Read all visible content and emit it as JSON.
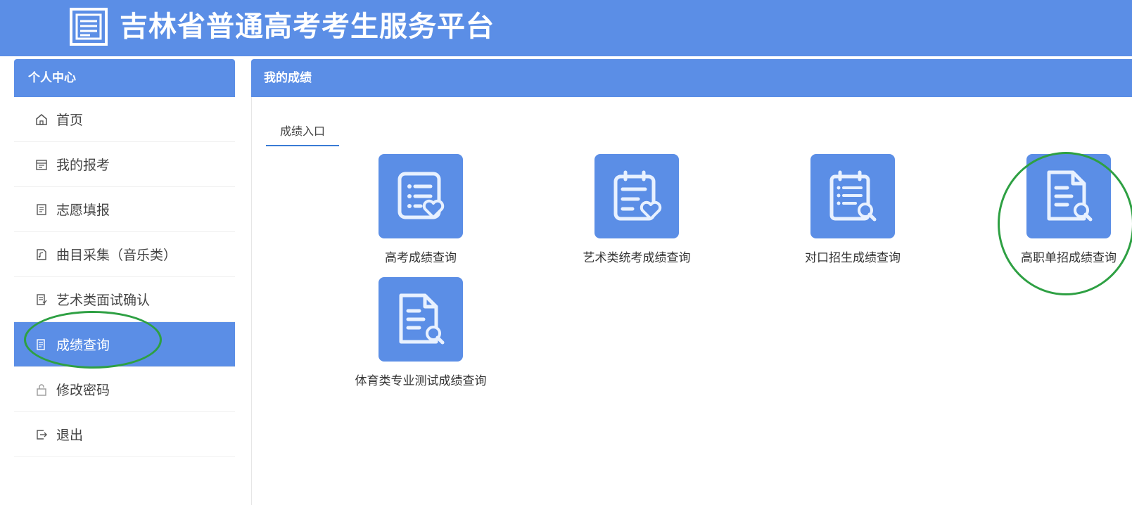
{
  "header": {
    "title": "吉林省普通高考考生服务平台",
    "logo_icon": "document-logo-icon",
    "bg_color": "#5b8ee6"
  },
  "sidebar": {
    "title": "个人中心",
    "items": [
      {
        "label": "首页",
        "icon": "home-icon"
      },
      {
        "label": "我的报考",
        "icon": "calendar-icon"
      },
      {
        "label": "志愿填报",
        "icon": "form-icon"
      },
      {
        "label": "曲目采集（音乐类）",
        "icon": "music-file-icon"
      },
      {
        "label": "艺术类面试确认",
        "icon": "confirm-doc-icon"
      },
      {
        "label": "成绩查询",
        "icon": "score-doc-icon",
        "active": true
      },
      {
        "label": "修改密码",
        "icon": "lock-icon"
      },
      {
        "label": "退出",
        "icon": "logout-icon"
      }
    ]
  },
  "main": {
    "title": "我的成绩",
    "tab": "成绩入口",
    "tiles": [
      {
        "label": "高考成绩查询",
        "icon": "list-heart-icon"
      },
      {
        "label": "艺术类统考成绩查询",
        "icon": "clipboard-heart-icon"
      },
      {
        "label": "对口招生成绩查询",
        "icon": "clipboard-search-icon"
      },
      {
        "label": "高职单招成绩查询",
        "icon": "document-search-icon"
      },
      {
        "label": "体育类专业测试成绩查询",
        "icon": "document-search-icon"
      }
    ]
  },
  "colors": {
    "accent": "#5b8ee6",
    "annotation": "#2ea043"
  }
}
